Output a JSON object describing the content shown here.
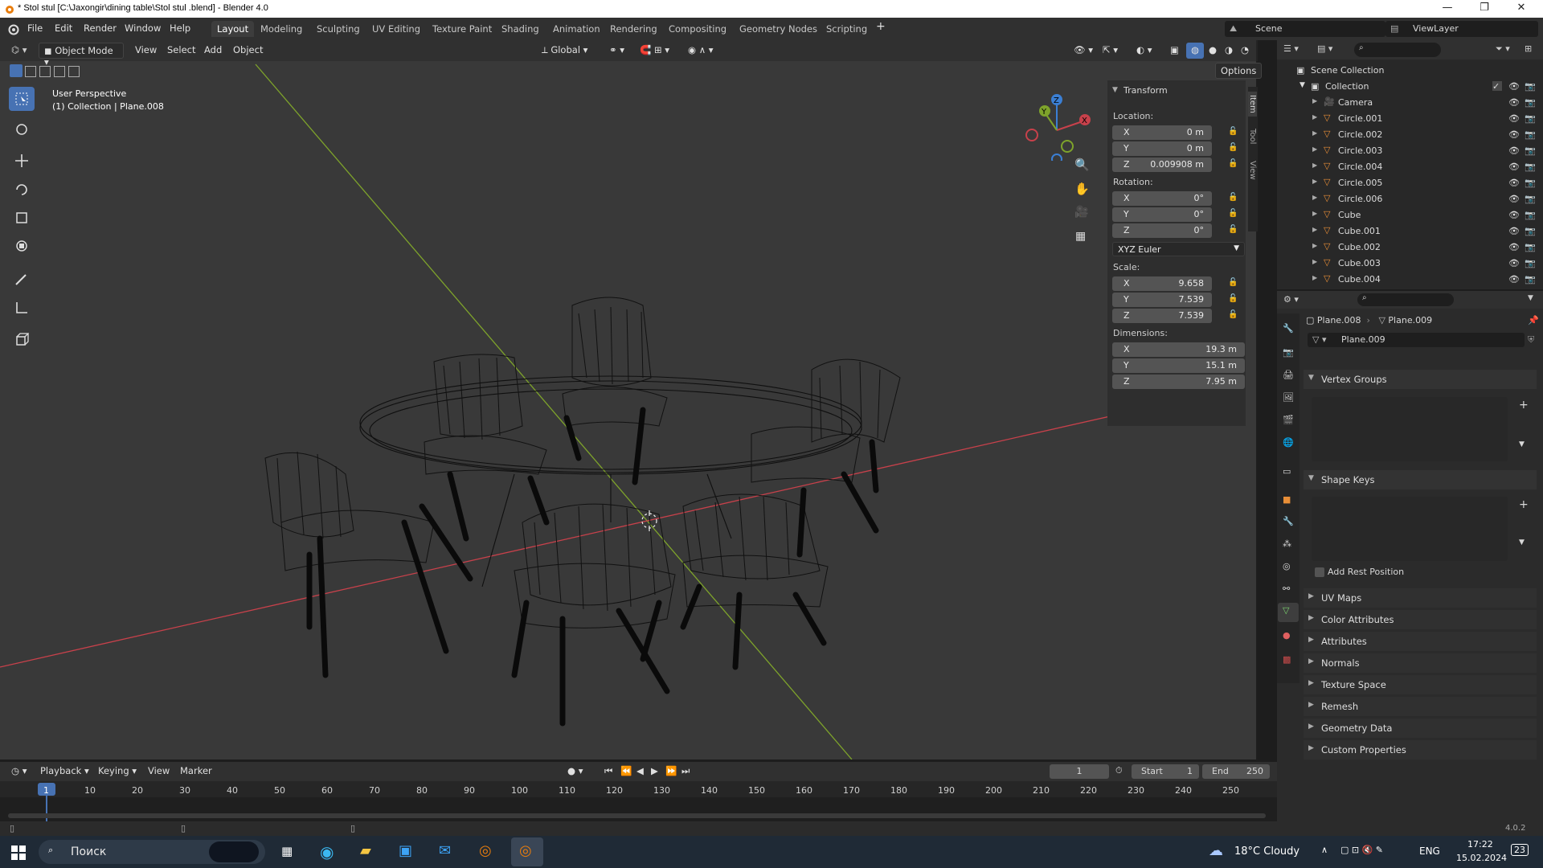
{
  "window": {
    "title": "* Stol stul  [C:\\Jaxongir\\dining table\\Stol stul .blend] - Blender 4.0"
  },
  "menu": [
    "File",
    "Edit",
    "Render",
    "Window",
    "Help"
  ],
  "workspaces": [
    "Layout",
    "Modeling",
    "Sculpting",
    "UV Editing",
    "Texture Paint",
    "Shading",
    "Animation",
    "Rendering",
    "Compositing",
    "Geometry Nodes",
    "Scripting"
  ],
  "active_workspace": "Layout",
  "scene": {
    "name": "Scene",
    "view_layer": "ViewLayer"
  },
  "viewport": {
    "mode": "Object Mode",
    "menus": [
      "View",
      "Select",
      "Add",
      "Object"
    ],
    "orientation": "Global",
    "options_label": "Options",
    "perspective": "User Perspective",
    "collection_info": "(1) Collection | Plane.008"
  },
  "sidebar_tabs": [
    "Item",
    "Tool",
    "View"
  ],
  "transform": {
    "header": "Transform",
    "location_label": "Location:",
    "location": [
      {
        "axis": "X",
        "value": "0 m"
      },
      {
        "axis": "Y",
        "value": "0 m"
      },
      {
        "axis": "Z",
        "value": "0.009908 m"
      }
    ],
    "rotation_label": "Rotation:",
    "rotation": [
      {
        "axis": "X",
        "value": "0°"
      },
      {
        "axis": "Y",
        "value": "0°"
      },
      {
        "axis": "Z",
        "value": "0°"
      }
    ],
    "rotation_mode": "XYZ Euler",
    "scale_label": "Scale:",
    "scale": [
      {
        "axis": "X",
        "value": "9.658"
      },
      {
        "axis": "Y",
        "value": "7.539"
      },
      {
        "axis": "Z",
        "value": "7.539"
      }
    ],
    "dimensions_label": "Dimensions:",
    "dimensions": [
      {
        "axis": "X",
        "value": "19.3 m"
      },
      {
        "axis": "Y",
        "value": "15.1 m"
      },
      {
        "axis": "Z",
        "value": "7.95 m"
      }
    ]
  },
  "outliner": {
    "scene_collection": "Scene Collection",
    "collection": "Collection",
    "items": [
      "Camera",
      "Circle.001",
      "Circle.002",
      "Circle.003",
      "Circle.004",
      "Circle.005",
      "Circle.006",
      "Cube",
      "Cube.001",
      "Cube.002",
      "Cube.003",
      "Cube.004"
    ]
  },
  "properties": {
    "object": "Plane.008",
    "mesh": "Plane.009",
    "datablock": "Plane.009",
    "panels": {
      "vertex_groups": "Vertex Groups",
      "shape_keys": "Shape Keys",
      "add_rest_position": "Add Rest Position",
      "uv_maps": "UV Maps",
      "color_attributes": "Color Attributes",
      "attributes": "Attributes",
      "normals": "Normals",
      "texture_space": "Texture Space",
      "remesh": "Remesh",
      "geometry_data": "Geometry Data",
      "custom_properties": "Custom Properties"
    }
  },
  "timeline": {
    "menus": [
      "Playback",
      "Keying",
      "View",
      "Marker"
    ],
    "current_frame": "1",
    "start_label": "Start",
    "start": "1",
    "end_label": "End",
    "end": "250",
    "ticks": [
      "1",
      "10",
      "20",
      "30",
      "40",
      "50",
      "60",
      "70",
      "80",
      "90",
      "100",
      "110",
      "120",
      "130",
      "140",
      "150",
      "160",
      "170",
      "180",
      "190",
      "200",
      "210",
      "220",
      "230",
      "240",
      "250"
    ]
  },
  "status": {
    "version": "4.0.2"
  },
  "taskbar": {
    "search_placeholder": "Поиск",
    "weather": "18°C  Cloudy",
    "lang": "ENG",
    "time": "17:22",
    "date": "15.02.2024",
    "notifications": "23"
  },
  "colors": {
    "accent": "#4772b3",
    "x_axis": "#c8414b",
    "y_axis": "#7ea32b",
    "z_axis": "#3b7fd4"
  }
}
